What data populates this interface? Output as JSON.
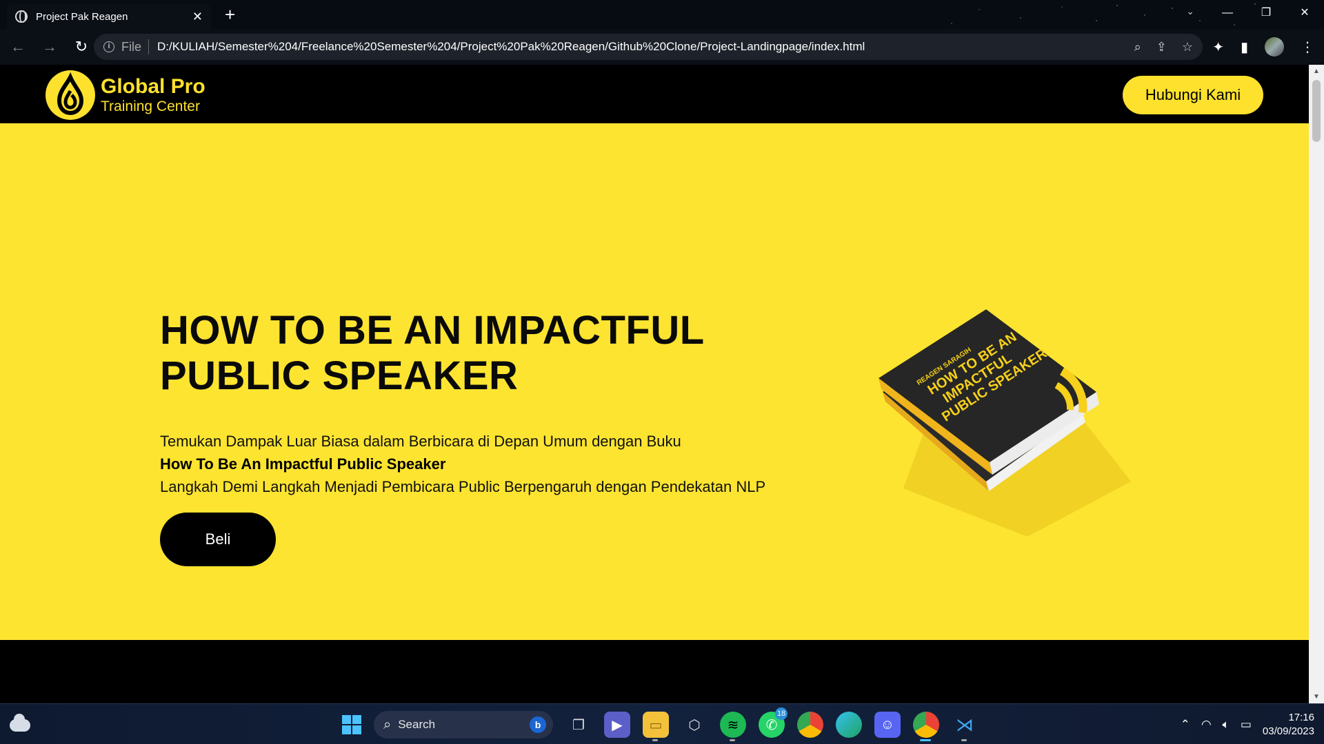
{
  "browser": {
    "tab_title": "Project Pak Reagen",
    "tab_close": "✕",
    "new_tab": "+",
    "file_label": "File",
    "url": "D:/KULIAH/Semester%204/Freelance%20Semester%204/Project%20Pak%20Reagen/Github%20Clone/Project-Landingpage/index.html"
  },
  "site": {
    "logo_name": "Global Pro",
    "logo_sub": "Training Center",
    "contact_button": "Hubungi Kami"
  },
  "hero": {
    "title": "HOW TO BE AN IMPACTFUL PUBLIC SPEAKER",
    "desc_line1": "Temukan Dampak Luar Biasa dalam Berbicara di Depan Umum dengan Buku",
    "desc_line2": "How To Be An Impactful Public Speaker",
    "desc_line3": "Langkah Demi Langkah Menjadi Pembicara Public Berpengaruh dengan Pendekatan NLP",
    "buy_button": "Beli"
  },
  "book": {
    "author": "REAGEN SARAGIH",
    "title_line1": "HOW TO BE AN",
    "title_line2": "IMPACTFUL",
    "title_line3": "PUBLIC SPEAKER"
  },
  "taskbar": {
    "search_label": "Search",
    "whatsapp_badge": "18",
    "time": "17:16",
    "date": "03/09/2023"
  },
  "colors": {
    "brand_yellow": "#fde12d",
    "hero_bg": "#fde430",
    "dark": "#000000"
  }
}
